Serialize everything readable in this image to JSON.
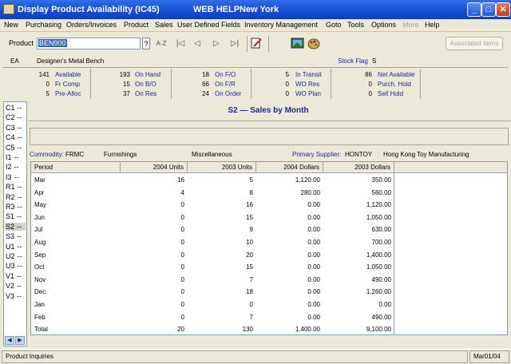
{
  "window": {
    "title": "Display Product Availability (IC45)",
    "help": "WEB HELP",
    "location": "New York"
  },
  "menu": [
    "New",
    "Purchasing",
    "Orders/Invoices",
    "Product",
    "Sales",
    "User Defined Fields",
    "Inventory Management",
    "Goto",
    "Tools",
    "Options",
    "More",
    "Help"
  ],
  "toolbar": {
    "product_label": "Product",
    "product_value": "BEN900",
    "query_btn": "?",
    "sort_btn": "A-Z",
    "nav_first": "|◁",
    "nav_prev": "◁",
    "nav_next": "▷",
    "nav_last": "▷|",
    "associated_items": "Associated Items"
  },
  "header": {
    "unit": "EA",
    "description": "Designer's Metal Bench",
    "stock_flag_label": "Stock Flag",
    "stock_flag_value": "S",
    "col1": [
      {
        "n": "141",
        "l": "Available"
      },
      {
        "n": "0",
        "l": "Fr Comp"
      },
      {
        "n": "5",
        "l": "Pre-Alloc"
      }
    ],
    "col2": [
      {
        "n": "193",
        "l": "On Hand"
      },
      {
        "n": "15",
        "l": "On B/O"
      },
      {
        "n": "37",
        "l": "On Res"
      }
    ],
    "col3": [
      {
        "n": "18",
        "l": "On F/O"
      },
      {
        "n": "66",
        "l": "On F/R"
      },
      {
        "n": "24",
        "l": "On Order"
      }
    ],
    "col4": [
      {
        "n": "5",
        "l": "In Transit"
      },
      {
        "n": "0",
        "l": "WO Res"
      },
      {
        "n": "0",
        "l": "WO Plan"
      }
    ],
    "col5": [
      {
        "n": "86",
        "l": "Net Available"
      },
      {
        "n": "0",
        "l": "Purch. Hold"
      },
      {
        "n": "0",
        "l": "Sell Hold"
      }
    ]
  },
  "sidebar": [
    "C1",
    "C2",
    "C3",
    "C4",
    "C5",
    "I1",
    "I2",
    "I3",
    "R1",
    "R2",
    "R3",
    "S1",
    "S2",
    "S3",
    "U1",
    "U2",
    "U3",
    "V1",
    "V2",
    "V3"
  ],
  "sidebar_suffix": "--",
  "section": {
    "title": "S2  —   Sales by Month",
    "commodity_label": "Commodity:",
    "commodity_code": "FRMC",
    "commodity_name": "Furnishings",
    "class": "Miscellaneous",
    "supplier_label": "Primary Supplier:",
    "supplier_code": "HONTOY",
    "supplier_name": "Hong Kong Toy Manufacturing"
  },
  "table": {
    "headers": [
      "Period",
      "2004  Units",
      "2003  Units",
      "2004  Dollars",
      "2003  Dollars"
    ],
    "rows": [
      [
        "Mar",
        "16",
        "5",
        "1,120.00",
        "350.00"
      ],
      [
        "Apr",
        "4",
        "8",
        "280.00",
        "560.00"
      ],
      [
        "May",
        "0",
        "16",
        "0.00",
        "1,120.00"
      ],
      [
        "Jun",
        "0",
        "15",
        "0.00",
        "1,050.00"
      ],
      [
        "Jul",
        "0",
        "9",
        "0.00",
        "630.00"
      ],
      [
        "Aug",
        "0",
        "10",
        "0.00",
        "700.00"
      ],
      [
        "Sep",
        "0",
        "20",
        "0.00",
        "1,400.00"
      ],
      [
        "Oct",
        "0",
        "15",
        "0.00",
        "1,050.00"
      ],
      [
        "Nov",
        "0",
        "7",
        "0.00",
        "490.00"
      ],
      [
        "Dec",
        "0",
        "18",
        "0.00",
        "1,260.00"
      ],
      [
        "Jan",
        "0",
        "0",
        "0.00",
        "0.00"
      ],
      [
        "Feb",
        "0",
        "7",
        "0.00",
        "490.00"
      ],
      [
        "Total",
        "20",
        "130",
        "1,400.00",
        "9,100.00"
      ]
    ]
  },
  "status": {
    "left": "Product Inquiries",
    "right": "Mar01/04"
  }
}
